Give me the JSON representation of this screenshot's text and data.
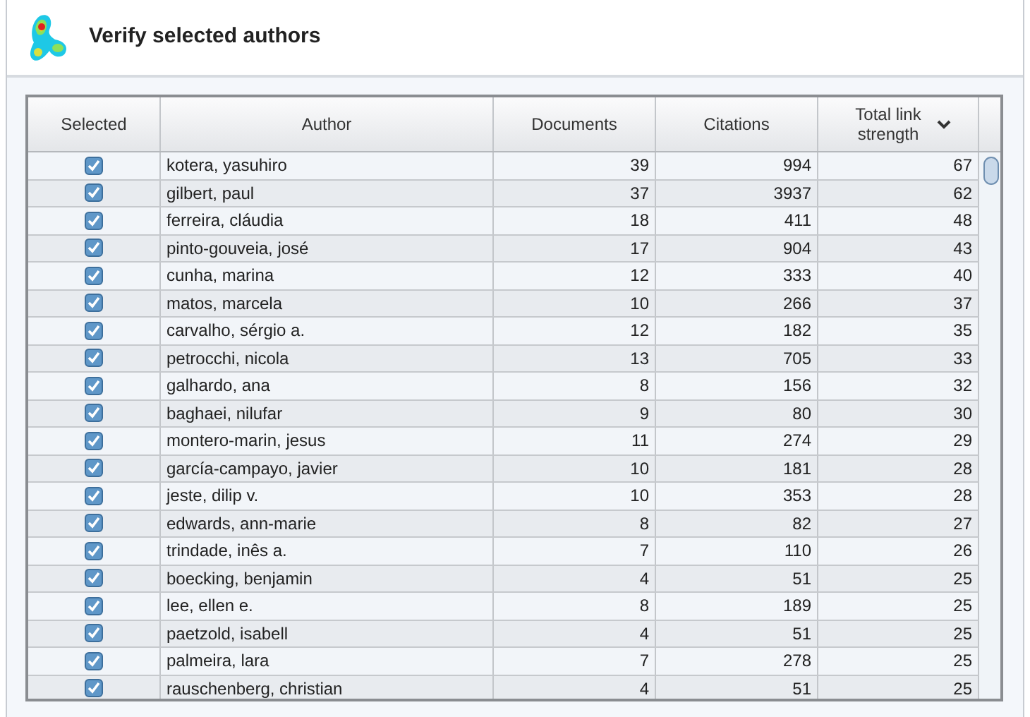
{
  "dialog": {
    "title": "Verify selected authors"
  },
  "table": {
    "columns": [
      {
        "label": "Selected",
        "sorted": false
      },
      {
        "label": "Author",
        "sorted": false
      },
      {
        "label": "Documents",
        "sorted": false
      },
      {
        "label": "Citations",
        "sorted": false
      },
      {
        "label": "Total link strength",
        "sorted": true
      }
    ],
    "rows": [
      {
        "selected": true,
        "author": "kotera, yasuhiro",
        "documents": "39",
        "citations": "994",
        "total_link_strength": "67"
      },
      {
        "selected": true,
        "author": "gilbert, paul",
        "documents": "37",
        "citations": "3937",
        "total_link_strength": "62"
      },
      {
        "selected": true,
        "author": "ferreira, cláudia",
        "documents": "18",
        "citations": "411",
        "total_link_strength": "48"
      },
      {
        "selected": true,
        "author": "pinto-gouveia, josé",
        "documents": "17",
        "citations": "904",
        "total_link_strength": "43"
      },
      {
        "selected": true,
        "author": "cunha, marina",
        "documents": "12",
        "citations": "333",
        "total_link_strength": "40"
      },
      {
        "selected": true,
        "author": "matos, marcela",
        "documents": "10",
        "citations": "266",
        "total_link_strength": "37"
      },
      {
        "selected": true,
        "author": "carvalho, sérgio a.",
        "documents": "12",
        "citations": "182",
        "total_link_strength": "35"
      },
      {
        "selected": true,
        "author": "petrocchi, nicola",
        "documents": "13",
        "citations": "705",
        "total_link_strength": "33"
      },
      {
        "selected": true,
        "author": "galhardo, ana",
        "documents": "8",
        "citations": "156",
        "total_link_strength": "32"
      },
      {
        "selected": true,
        "author": "baghaei, nilufar",
        "documents": "9",
        "citations": "80",
        "total_link_strength": "30"
      },
      {
        "selected": true,
        "author": "montero-marin, jesus",
        "documents": "11",
        "citations": "274",
        "total_link_strength": "29"
      },
      {
        "selected": true,
        "author": "garcía-campayo, javier",
        "documents": "10",
        "citations": "181",
        "total_link_strength": "28"
      },
      {
        "selected": true,
        "author": "jeste, dilip v.",
        "documents": "10",
        "citations": "353",
        "total_link_strength": "28"
      },
      {
        "selected": true,
        "author": "edwards, ann-marie",
        "documents": "8",
        "citations": "82",
        "total_link_strength": "27"
      },
      {
        "selected": true,
        "author": "trindade, inês a.",
        "documents": "7",
        "citations": "110",
        "total_link_strength": "26"
      },
      {
        "selected": true,
        "author": "boecking, benjamin",
        "documents": "4",
        "citations": "51",
        "total_link_strength": "25"
      },
      {
        "selected": true,
        "author": "lee, ellen e.",
        "documents": "8",
        "citations": "189",
        "total_link_strength": "25"
      },
      {
        "selected": true,
        "author": "paetzold, isabell",
        "documents": "4",
        "citations": "51",
        "total_link_strength": "25"
      },
      {
        "selected": true,
        "author": "palmeira, lara",
        "documents": "7",
        "citations": "278",
        "total_link_strength": "25"
      },
      {
        "selected": true,
        "author": "rauschenberg, christian",
        "documents": "4",
        "citations": "51",
        "total_link_strength": "25"
      }
    ]
  }
}
